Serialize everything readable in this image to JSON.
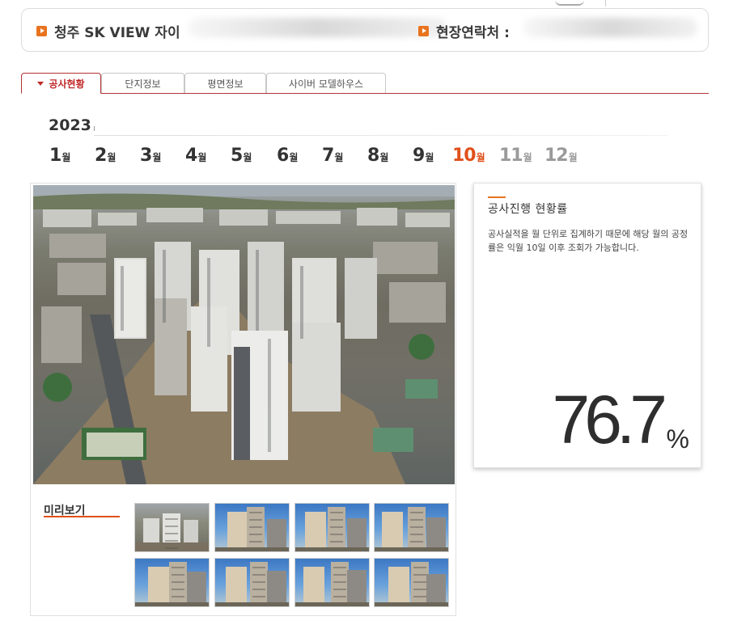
{
  "site": {
    "name": "청주 SK VIEW 자이",
    "contact_label": "현장연락처 :"
  },
  "tabs": [
    {
      "label": "공사현황",
      "active": true
    },
    {
      "label": "단지정보",
      "active": false
    },
    {
      "label": "평면정보",
      "active": false
    },
    {
      "label": "사이버 모델하우스",
      "active": false
    }
  ],
  "timeline": {
    "year": "2023",
    "month_unit": "월",
    "months": [
      {
        "num": "1",
        "state": "available"
      },
      {
        "num": "2",
        "state": "available"
      },
      {
        "num": "3",
        "state": "available"
      },
      {
        "num": "4",
        "state": "available"
      },
      {
        "num": "5",
        "state": "available"
      },
      {
        "num": "6",
        "state": "available"
      },
      {
        "num": "7",
        "state": "available"
      },
      {
        "num": "8",
        "state": "available"
      },
      {
        "num": "9",
        "state": "available"
      },
      {
        "num": "10",
        "state": "selected"
      },
      {
        "num": "11",
        "state": "unavailable"
      },
      {
        "num": "12",
        "state": "unavailable"
      }
    ]
  },
  "gallery": {
    "preview_label": "미리보기",
    "thumbnails": [
      {
        "kind": "aerial"
      },
      {
        "kind": "sky"
      },
      {
        "kind": "sky"
      },
      {
        "kind": "sky"
      },
      {
        "kind": "sky"
      },
      {
        "kind": "sky"
      },
      {
        "kind": "sky"
      },
      {
        "kind": "sky"
      }
    ]
  },
  "progress": {
    "title": "공사진행 현황률",
    "note": "공사실적을 월 단위로 집계하기 때문에 해당 월의 공정률은 익월 10일 이후 조회가 가능합니다.",
    "value": "76.7",
    "unit": "%"
  },
  "colors": {
    "accent_orange": "#e0501a",
    "tab_red": "#c02828",
    "inactive_gray": "#9a9a9a"
  }
}
